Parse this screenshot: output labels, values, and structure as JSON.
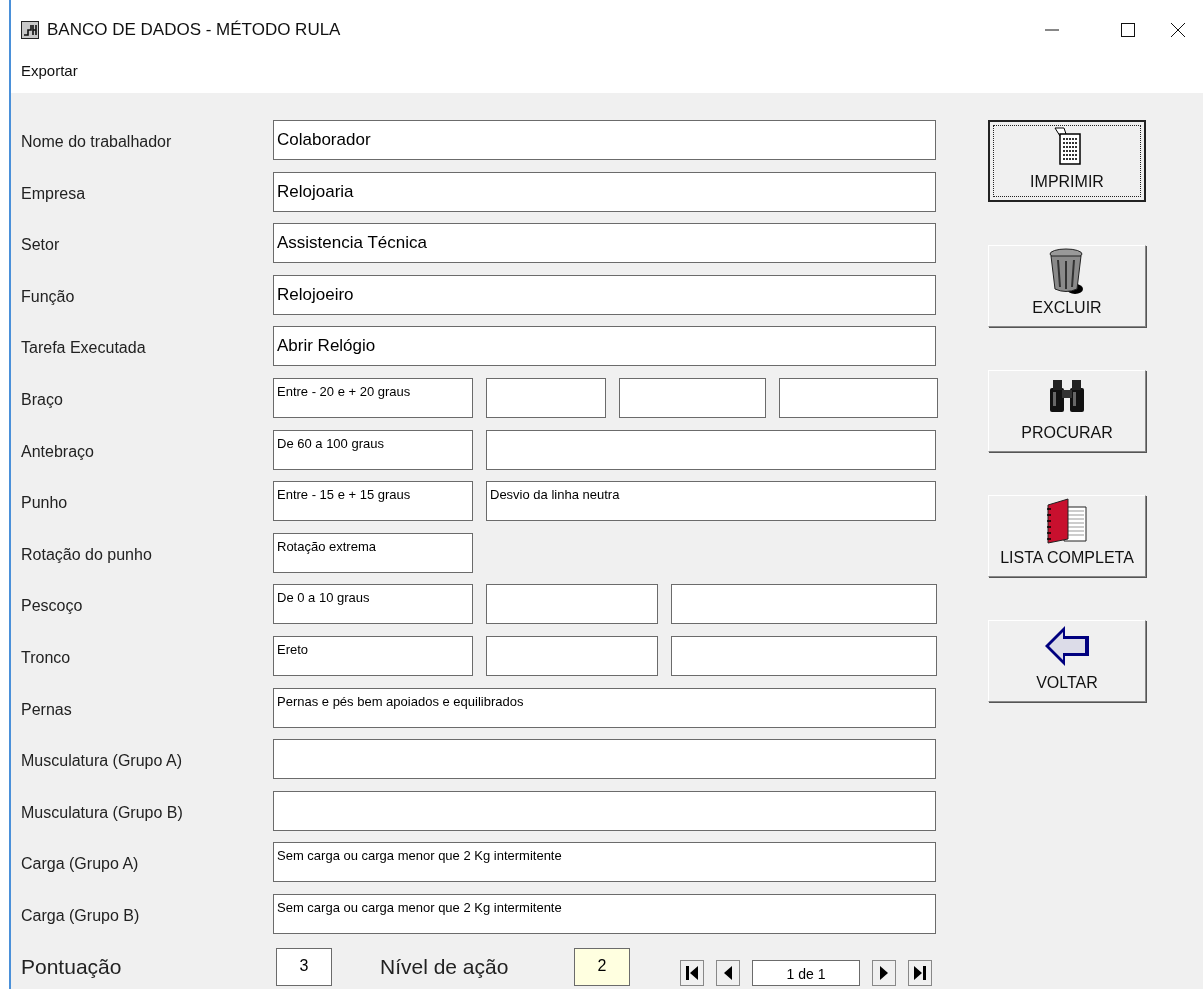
{
  "window": {
    "title": "BANCO DE DADOS - MÉTODO RULA"
  },
  "menu": [
    "Exportar"
  ],
  "rows": [
    {
      "label": "Nome do trabalhador",
      "kind": "full",
      "fields": [
        "Colaborador"
      ]
    },
    {
      "label": "Empresa",
      "kind": "full",
      "fields": [
        "Relojoaria"
      ]
    },
    {
      "label": "Setor",
      "kind": "full",
      "fields": [
        "Assistencia Técnica"
      ]
    },
    {
      "label": "Função",
      "kind": "full",
      "fields": [
        "Relojoeiro"
      ]
    },
    {
      "label": "Tarefa Executada",
      "kind": "full",
      "fields": [
        "Abrir Relógio"
      ]
    },
    {
      "label": "Braço",
      "kind": "quad",
      "fields": [
        "Entre - 20 e + 20 graus"
      ]
    },
    {
      "label": "Antebraço",
      "kind": "pair",
      "fields": [
        "De 60 a 100 graus"
      ]
    },
    {
      "label": "Punho",
      "kind": "pair",
      "fields": [
        "Entre - 15 e + 15 graus",
        "Desvio da linha neutra"
      ]
    },
    {
      "label": "Rotação do punho",
      "kind": "single",
      "fields": [
        "Rotação extrema"
      ]
    },
    {
      "label": "Pescoço",
      "kind": "triple",
      "fields": [
        "De 0 a 10 graus"
      ]
    },
    {
      "label": "Tronco",
      "kind": "triple",
      "fields": [
        "Ereto"
      ]
    },
    {
      "label": "Pernas",
      "kind": "small",
      "fields": [
        "Pernas e pés bem apoiados e equilibrados"
      ]
    },
    {
      "label": "Musculatura (Grupo A)",
      "kind": "full"
    },
    {
      "label": "Musculatura (Grupo B)",
      "kind": "full"
    },
    {
      "label": "Carga (Grupo A)",
      "kind": "small",
      "fields": [
        "Sem carga ou carga menor que 2 Kg intermitente"
      ]
    },
    {
      "label": "Carga (Grupo B)",
      "kind": "small",
      "fields": [
        "Sem carga ou carga menor que 2 Kg intermitente"
      ]
    }
  ],
  "score": {
    "label": "Pontuação",
    "value": "3"
  },
  "action_level": {
    "label": "Nível de ação",
    "value": "2"
  },
  "record_counter": "1 de 1",
  "buttons": [
    {
      "label": "IMPRIMIR",
      "kind": "print",
      "focused": true
    },
    {
      "label": "EXCLUIR",
      "kind": "trash",
      "focused": false
    },
    {
      "label": "PROCURAR",
      "kind": "search",
      "focused": false
    },
    {
      "label": "LISTA COMPLETA",
      "kind": "list",
      "focused": false
    },
    {
      "label": "VOLTAR",
      "kind": "back",
      "focused": false
    }
  ]
}
